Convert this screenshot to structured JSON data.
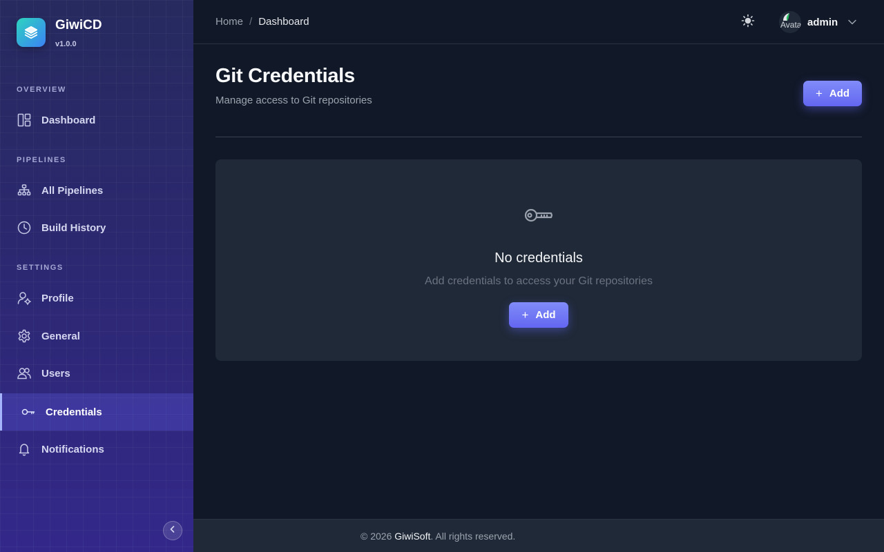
{
  "brand": {
    "name": "GiwiCD",
    "version": "v1.0.0"
  },
  "sidebar": {
    "sections": [
      {
        "title": "OVERVIEW"
      },
      {
        "title": "PIPELINES"
      },
      {
        "title": "SETTINGS"
      }
    ],
    "items": [
      {
        "label": "Dashboard",
        "icon": "dashboard-icon"
      },
      {
        "label": "All Pipelines",
        "icon": "pipelines-icon"
      },
      {
        "label": "Build History",
        "icon": "history-icon"
      },
      {
        "label": "Profile",
        "icon": "profile-icon"
      },
      {
        "label": "General",
        "icon": "gear-icon"
      },
      {
        "label": "Users",
        "icon": "users-icon"
      },
      {
        "label": "Credentials",
        "icon": "key-icon",
        "active": true
      },
      {
        "label": "Notifications",
        "icon": "bell-icon"
      }
    ],
    "collapse_icon": "chevron-left-icon"
  },
  "header": {
    "breadcrumb": {
      "home": "Home",
      "separator": "/",
      "current": "Dashboard"
    },
    "theme_icon": "sun-icon",
    "user": {
      "name": "admin",
      "avatar_alt": "Avatar"
    }
  },
  "main": {
    "title": "Git Credentials",
    "subtitle": "Manage access to Git repositories",
    "add_label": "Add",
    "empty": {
      "icon": "key-icon",
      "title": "No credentials",
      "description": "Add credentials to access your Git repositories",
      "add_label": "Add"
    }
  },
  "footer": {
    "prefix": "© 2026",
    "brand": "GiwiSoft",
    "suffix": ". All rights reserved."
  },
  "colors": {
    "accent": "#6366f1",
    "background": "#111827",
    "card": "#1f2937",
    "sidebar": "#2c2870"
  }
}
